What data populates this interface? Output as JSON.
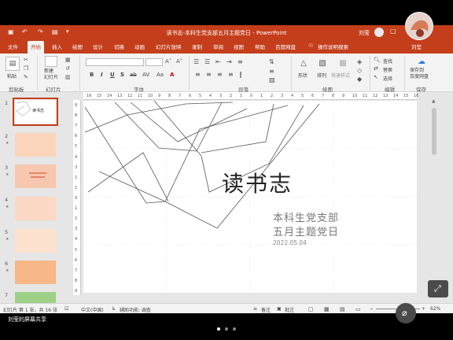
{
  "window": {
    "title": "读书志-本科生党支部五月主题党日 - PowerPoint",
    "user_name": "刘莹",
    "controls": [
      "—",
      "❐",
      "✕"
    ]
  },
  "quick_access": [
    "💾",
    "↶",
    "↷",
    "⊞"
  ],
  "menu_tabs": [
    {
      "label": "文件",
      "active": false
    },
    {
      "label": "开始",
      "active": true
    },
    {
      "label": "插入",
      "active": false
    },
    {
      "label": "绘图",
      "active": false
    },
    {
      "label": "设计",
      "active": false
    },
    {
      "label": "切换",
      "active": false
    },
    {
      "label": "动画",
      "active": false
    },
    {
      "label": "幻灯片放映",
      "active": false
    },
    {
      "label": "录制",
      "active": false
    },
    {
      "label": "审阅",
      "active": false
    },
    {
      "label": "视图",
      "active": false
    },
    {
      "label": "帮助",
      "active": false
    },
    {
      "label": "百度网盘",
      "active": false
    },
    {
      "label": "操作说明搜索",
      "active": false
    }
  ],
  "ribbon": {
    "paste": "粘贴",
    "new_slide": "新建\n幻灯片",
    "shapes": "形状",
    "arrange": "排列",
    "quick_styles": "快速样式",
    "find": "查找",
    "replace": "替换",
    "select": "选择",
    "save_to_cloud": "保存到\n百度网盘",
    "groups": {
      "clipboard": "剪贴板",
      "slides": "幻灯片",
      "font": "字体",
      "paragraph": "段落",
      "drawing": "绘图",
      "editing": "编辑",
      "save": "保存"
    },
    "format_buttons": [
      "B",
      "I",
      "U",
      "S",
      "ab",
      "AV",
      "Aa"
    ]
  },
  "ruler": {
    "horizontal_ticks": [
      "16",
      "15",
      "14",
      "13",
      "12",
      "11",
      "10",
      "9",
      "8",
      "7",
      "6",
      "5",
      "4",
      "3",
      "2",
      "1",
      "0",
      "1",
      "2",
      "3",
      "4",
      "5",
      "6",
      "7",
      "8",
      "9",
      "10",
      "11",
      "12",
      "13",
      "14",
      "15",
      "16"
    ],
    "vertical_ticks": [
      "9",
      "8",
      "7",
      "6",
      "5",
      "4",
      "3",
      "2",
      "1",
      "0",
      "1",
      "2",
      "3",
      "4",
      "5",
      "6",
      "7",
      "8",
      "9"
    ]
  },
  "slides": [
    {
      "num": "1",
      "title": "读书志",
      "color": "#ffffff"
    },
    {
      "num": "2",
      "title": "",
      "color": "#fad5bb"
    },
    {
      "num": "3",
      "title": "",
      "color": "#f8c7b0"
    },
    {
      "num": "4",
      "title": "",
      "color": "#fbd9c4"
    },
    {
      "num": "5",
      "title": "",
      "color": "#fde1cf"
    },
    {
      "num": "6",
      "title": "",
      "color": "#f7b787"
    },
    {
      "num": "7",
      "title": "",
      "color": "#9ed087"
    }
  ],
  "slide": {
    "title": "读书志",
    "subtitle_line1": "本科生党支部",
    "subtitle_line2": "五月主题党日",
    "date": "2022.05.04"
  },
  "statusbar": {
    "slide_count": "幻灯片 第 1 张，共 16 张",
    "language": "中文(中国)",
    "accessibility": "辅助功能: 调查",
    "notes": "备注",
    "comments": "批注",
    "zoom": "62%"
  },
  "overlay": {
    "share_text": "刘莹的屏幕共享",
    "presenter_label": "刘莹"
  },
  "colors": {
    "accent": "#c43e1c",
    "ribbon_bg": "#f3f3f3",
    "workspace_bg": "#e6e6e6"
  }
}
